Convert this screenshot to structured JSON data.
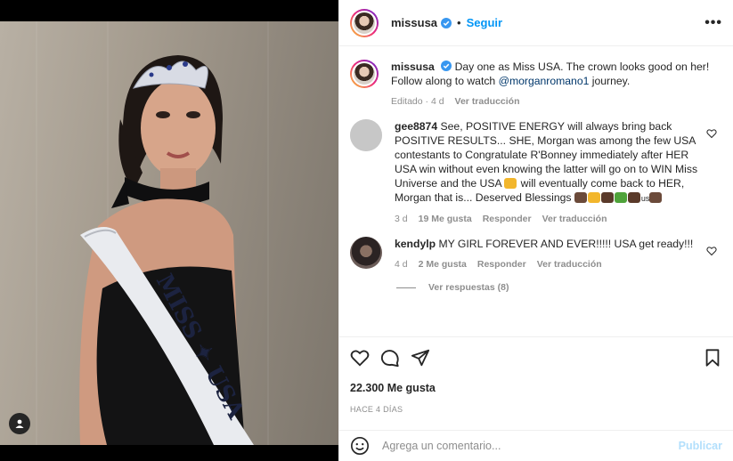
{
  "header": {
    "username": "missusa",
    "separator": "•",
    "follow_label": "Seguir",
    "more_icon": "more-icon"
  },
  "caption": {
    "username": "missusa",
    "text_before": "Day one as Miss USA. The crown looks good on her! Follow along to watch ",
    "mention": "@morganromano1",
    "text_after": " journey.",
    "edited": "Editado · 4 d",
    "translate": "Ver traducción"
  },
  "comments": [
    {
      "username": "gee8874",
      "text": "See, POSITIVE ENERGY will always bring back POSITIVE RESULTS... SHE, Morgan was among the few USA contestants to Congratulate R'Bonney immediately after HER USA win without even knowing the latter will go on to WIN Miss Universe and the USA ",
      "text_2": " will eventually come back to HER, Morgan that is... Deserved Blessings ",
      "emoji_us": "us",
      "time": "3 d",
      "likes": "19 Me gusta",
      "reply": "Responder",
      "translate": "Ver traducción"
    },
    {
      "username": "kendylp",
      "text": "MY GIRL FOREVER AND EVER!!!!! USA get ready!!!",
      "time": "4 d",
      "likes": "2 Me gusta",
      "reply": "Responder",
      "translate": "Ver traducción"
    }
  ],
  "replies_label": "Ver respuestas (8)",
  "stats": {
    "likes": "22.300 Me gusta",
    "time": "HACE 4 DÍAS"
  },
  "add_comment": {
    "placeholder": "Agrega un comentario...",
    "publish": "Publicar"
  },
  "colors": {
    "link": "#0095f6",
    "mention": "#00376b",
    "muted": "#8e8e8e",
    "publish_disabled": "#b2dffc"
  }
}
